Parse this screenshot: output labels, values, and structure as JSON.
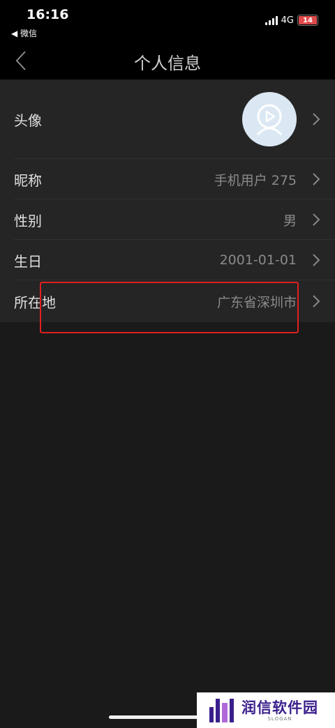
{
  "status_bar": {
    "time": "16:16",
    "back_app": "◀ 微信",
    "network": "4G",
    "battery": "14"
  },
  "nav": {
    "title": "个人信息"
  },
  "rows": [
    {
      "label": "头像",
      "value": ""
    },
    {
      "label": "昵称",
      "value": "手机用户 275"
    },
    {
      "label": "性别",
      "value": "男"
    },
    {
      "label": "生日",
      "value": "2001-01-01"
    },
    {
      "label": "所在地",
      "value": "广东省深圳市"
    }
  ],
  "watermark": {
    "title": "润信软件园",
    "slogan": "SLOGAN"
  },
  "colors": {
    "highlight": "#e02020",
    "brand": "#3a1f8c",
    "battery": "#e04a4a"
  }
}
